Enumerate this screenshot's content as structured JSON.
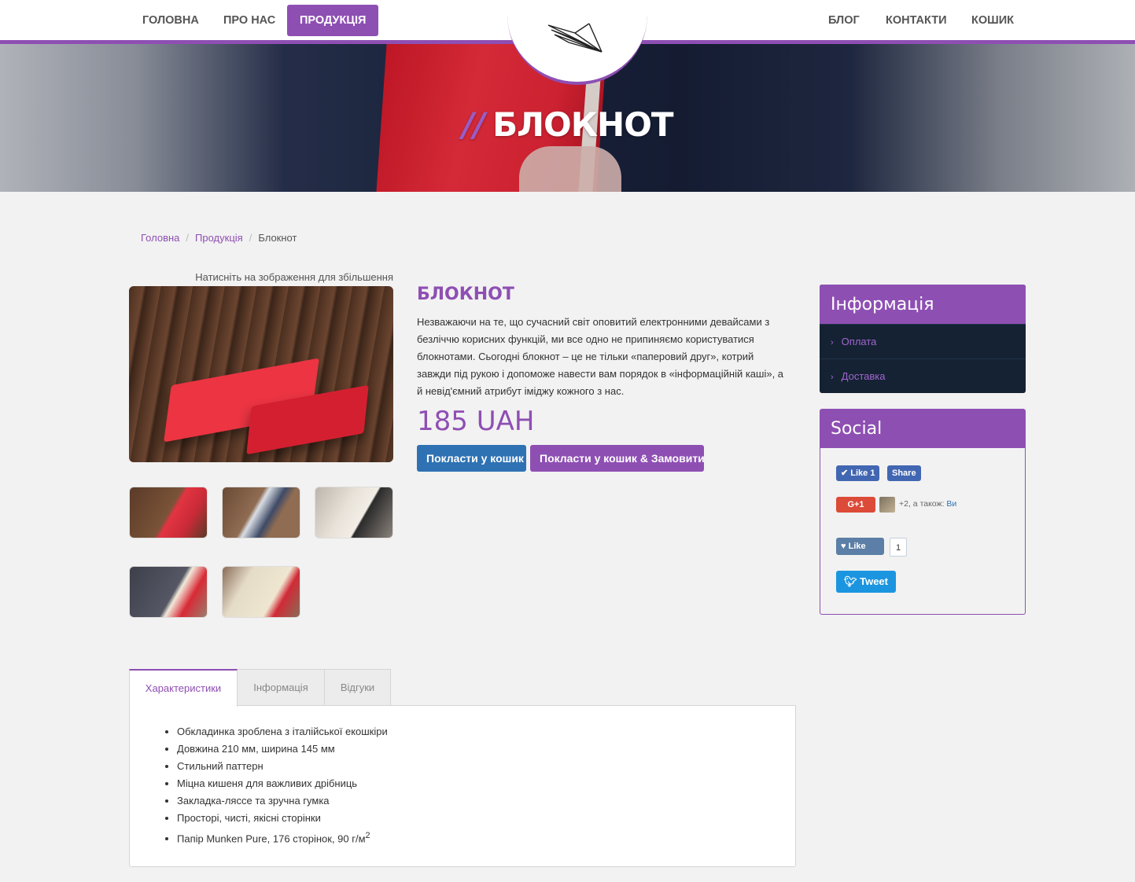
{
  "nav": {
    "left": [
      "ГОЛОВНА",
      "ПРО НАС",
      "ПРОДУКЦІЯ"
    ],
    "right": [
      "БЛОГ",
      "КОНТАКТИ",
      "КОШИК"
    ],
    "active": "ПРОДУКЦІЯ"
  },
  "hero": {
    "slash": "//",
    "title": "БЛОКНОТ"
  },
  "breadcrumb": {
    "home": "Головна",
    "products": "Продукція",
    "current": "Блокнот"
  },
  "gallery": {
    "zoom_hint": "Натисніть на зображення для збільшення"
  },
  "product": {
    "title": "БЛОКНОТ",
    "description": "Незважаючи на те, що сучасний світ оповитий електронними девайсами з безліччю корисних функцій, ми все одно не припиняємо користуватися блокнотами. Сьогодні блокнот – це не тільки «паперовий друг», котрий завжди під рукою і допоможе навести вам порядок в «інформаційній каші», а й невід'ємний атрибут іміджу кожного з нас.",
    "price": "185 UAH",
    "add_to_cart": "Покласти у кошик",
    "add_and_order": "Покласти у кошик & Замовити"
  },
  "sidebar": {
    "info_title": "Інформація",
    "info_links": [
      "Оплата",
      "Доставка"
    ],
    "social_title": "Social",
    "fb_like": "Like 1",
    "fb_share": "Share",
    "gplus": "G+1",
    "gplus_text": "+2, а також:",
    "gplus_link": "Ви",
    "vk_like": "Like",
    "vk_count": "1",
    "tweet": "Tweet"
  },
  "tabs": {
    "items": [
      "Характеристики",
      "Інформація",
      "Відгуки"
    ],
    "active": "Характеристики",
    "features": [
      "Обкладинка зроблена з італійської екошкіри",
      "Довжина 210 мм, ширина 145 мм",
      "Стильний паттерн",
      "Міцна кишеня для важливих дрібниць",
      "Закладка-ляссе та зручна гумка",
      "Просторі, чисті, якісні сторінки",
      "Папір Munken Pure, 176 сторінок, 90 г/м"
    ],
    "feature_superscript": "2"
  },
  "colors": {
    "accent": "#8e4fb3",
    "primary_button": "#2e72b4",
    "info_panel": "#152233"
  },
  "icons": [
    "paper-plane-logo-icon",
    "chevron-right-icon",
    "checkmark-icon",
    "heart-icon",
    "twitter-bird-icon"
  ]
}
